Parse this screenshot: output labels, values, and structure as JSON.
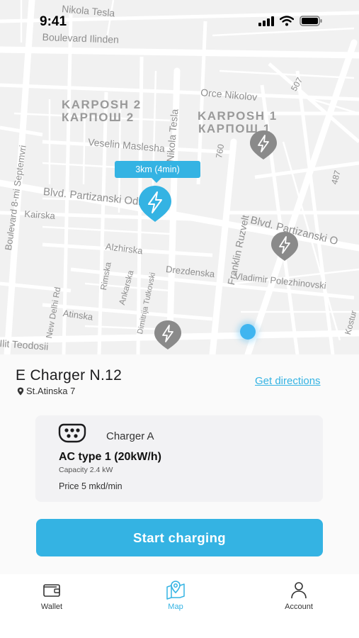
{
  "status_bar": {
    "time": "9:41"
  },
  "map": {
    "streets": [
      "Nikola Tesla",
      "Boulevard Ilinden",
      "Orce Nikolov",
      "507",
      "Veselin Maslesha",
      "Nikola Tesla",
      "760",
      "487",
      "Blvd. Partizanski Odredi",
      "Kairska",
      "Boulevard 8-mi Septemvri",
      "Blvd. Partizanski O",
      "Franklin Ruzvelt",
      "Alzhirska",
      "Drezdenska",
      "Vladimir Polezhinovski",
      "Rimska",
      "Ankarska",
      "New Delhi Rd",
      "Atinska",
      "Dimitrija Tutkovski",
      "Ilit Teodosii",
      "Kostur"
    ],
    "districts": [
      "KARPOSH 2",
      "КАРПОШ 2",
      "KARPOSH 1",
      "КАРПОШ 1"
    ],
    "selected_pin_bubble": "3km (4min)",
    "pin_icon": "lightning-icon"
  },
  "station": {
    "name": "E Charger N.12",
    "address": "St.Atinska 7",
    "directions_label": "Get directions"
  },
  "charger": {
    "name": "Charger A",
    "type": "AC type 1 (20kW/h)",
    "capacity": "Capacity 2.4 kW",
    "price": "Price 5 mkd/min"
  },
  "actions": {
    "start_label": "Start charging"
  },
  "tabs": [
    {
      "label": "Wallet",
      "icon": "wallet-icon",
      "active": false
    },
    {
      "label": "Map",
      "icon": "map-pin-icon",
      "active": true
    },
    {
      "label": "Account",
      "icon": "account-icon",
      "active": false
    }
  ],
  "colors": {
    "accent": "#34b3e3",
    "pin_inactive": "#8a8a8a",
    "map_bg": "#f1f1f1"
  }
}
